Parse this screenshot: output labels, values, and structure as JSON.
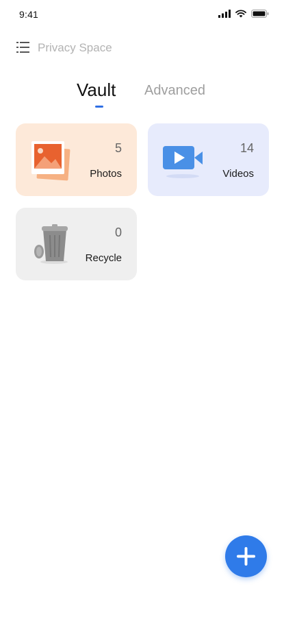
{
  "status_bar": {
    "time": "9:41"
  },
  "header": {
    "title": "Privacy Space",
    "menu_icon": "menu-list-icon"
  },
  "tabs": [
    {
      "label": "Vault",
      "active": true
    },
    {
      "label": "Advanced",
      "active": false
    }
  ],
  "cards": {
    "photos": {
      "label": "Photos",
      "count": "5",
      "icon": "photo-stack-icon",
      "color": "#fde9d9"
    },
    "videos": {
      "label": "Videos",
      "count": "14",
      "icon": "video-camera-icon",
      "color": "#e7ebfc"
    },
    "recycle": {
      "label": "Recycle",
      "count": "0",
      "icon": "trash-can-icon",
      "color": "#efefef"
    }
  },
  "fab": {
    "icon": "plus-icon",
    "color": "#2f7be9"
  },
  "colors": {
    "accent": "#2f6fe4"
  }
}
